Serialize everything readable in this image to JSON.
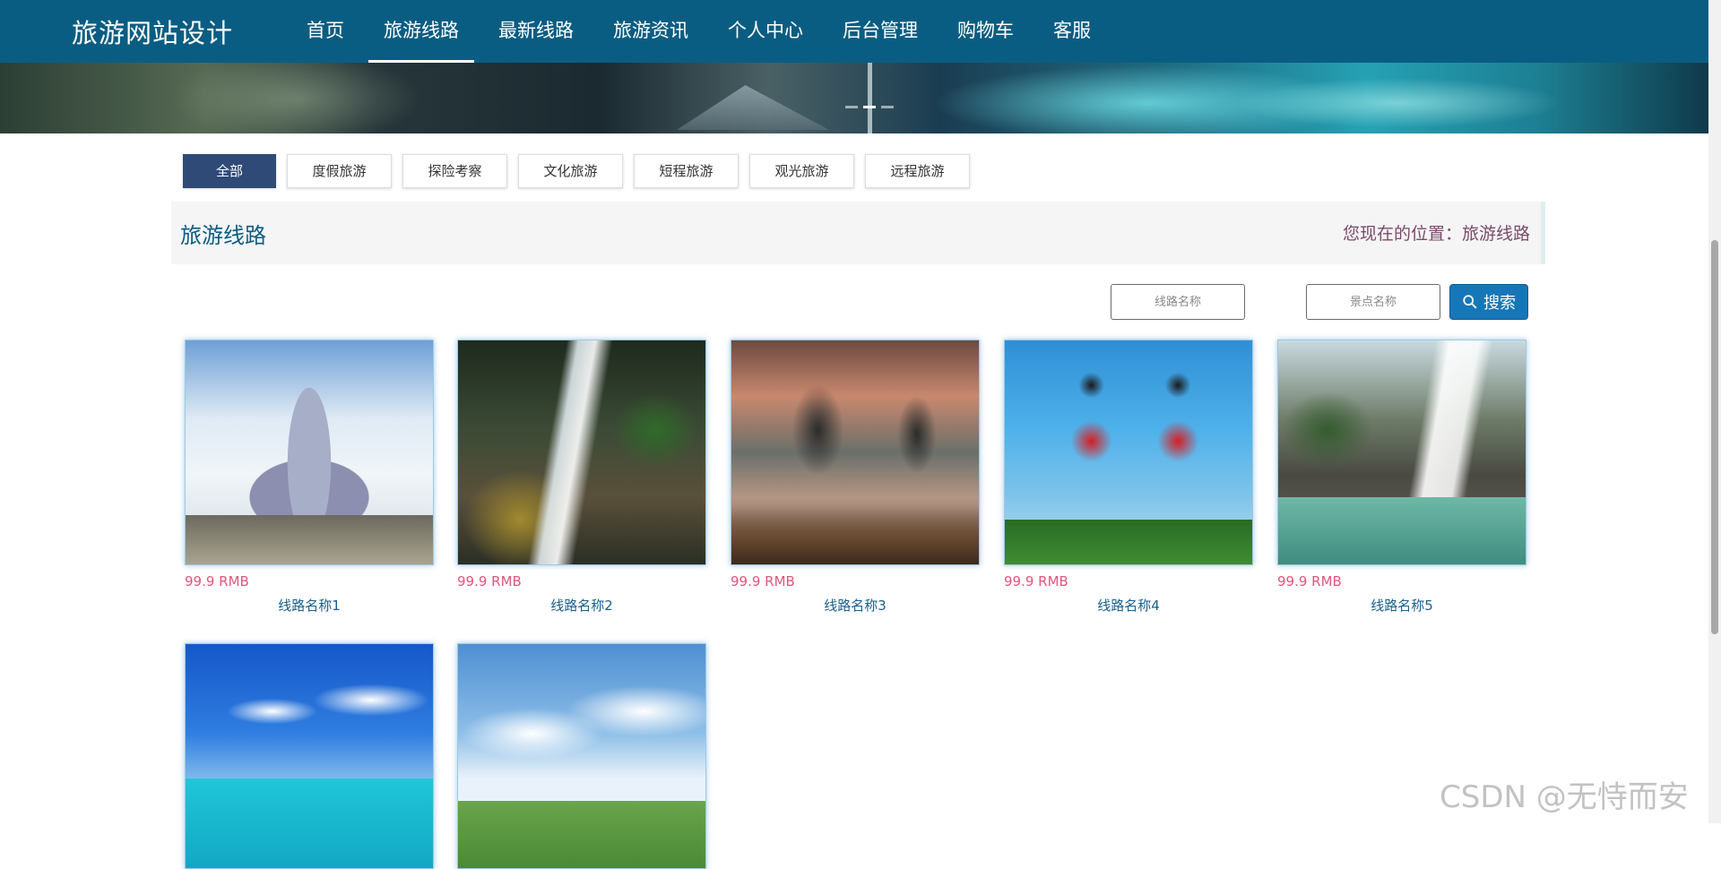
{
  "header": {
    "brand": "旅游网站设计",
    "nav": [
      "首页",
      "旅游线路",
      "最新线路",
      "旅游资讯",
      "个人中心",
      "后台管理",
      "购物车",
      "客服"
    ],
    "active_nav": "旅游线路"
  },
  "categories": [
    "全部",
    "度假旅游",
    "探险考察",
    "文化旅游",
    "短程旅游",
    "观光旅游",
    "远程旅游"
  ],
  "section": {
    "title": "旅游线路",
    "location_prefix": "您现在的位置：",
    "location_current": "旅游线路"
  },
  "search": {
    "route_placeholder": "线路名称",
    "spot_placeholder": "景点名称",
    "button_label": "搜索"
  },
  "routes": [
    {
      "price": "99.9 RMB",
      "name": "线路名称1",
      "image": "castle"
    },
    {
      "price": "99.9 RMB",
      "name": "线路名称2",
      "image": "waterfall"
    },
    {
      "price": "99.9 RMB",
      "name": "线路名称3",
      "image": "karst-river"
    },
    {
      "price": "99.9 RMB",
      "name": "线路名称4",
      "image": "mickey-minnie"
    },
    {
      "price": "99.9 RMB",
      "name": "线路名称5",
      "image": "pirate-ship"
    },
    {
      "image": "maldives"
    },
    {
      "image": "jeeps"
    }
  ],
  "watermark": "CSDN @无恃而安"
}
